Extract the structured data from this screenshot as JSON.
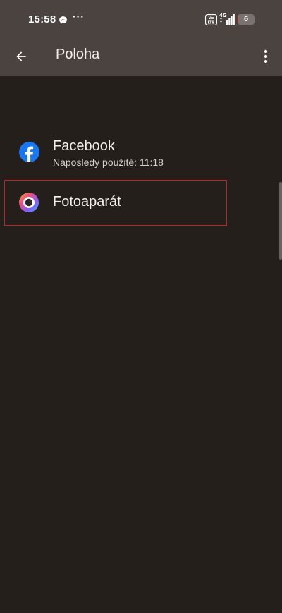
{
  "status_bar": {
    "time": "15:58",
    "more_notifications": "···",
    "volte_label": "Vo LTE",
    "network_label": "4G",
    "battery_level": "6"
  },
  "app_bar": {
    "title": "Poloha"
  },
  "apps": [
    {
      "name": "Facebook",
      "subtitle": "Naposledy použité: 11:18",
      "icon": "facebook-icon"
    },
    {
      "name": "Fotoaparát",
      "icon": "camera-icon"
    }
  ],
  "colors": {
    "status_bar_bg": "#4a4340",
    "background": "#251f1c",
    "highlight_border": "#b3262b",
    "facebook_blue": "#1877f2"
  }
}
